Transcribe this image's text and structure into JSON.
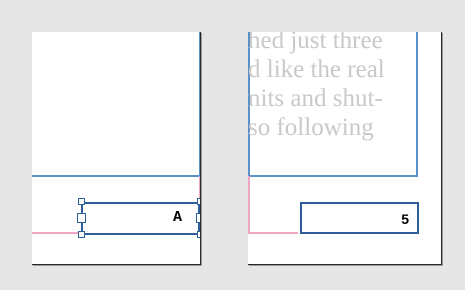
{
  "spread": {
    "left_page": {
      "page_number_marker": "A",
      "selected": true
    },
    "right_page": {
      "body_text_lines": [
        "hed just three",
        "d like the real",
        "nits and shut-",
        "so following"
      ],
      "page_number": "5"
    }
  },
  "colors": {
    "pasteboard": "#e6e6e6",
    "margin_guide": "#5b8fc7",
    "bleed_guide": "#f0a5c5",
    "frame_stroke": "#2f5f9a",
    "placeholder_text": "#c9c9c9"
  }
}
